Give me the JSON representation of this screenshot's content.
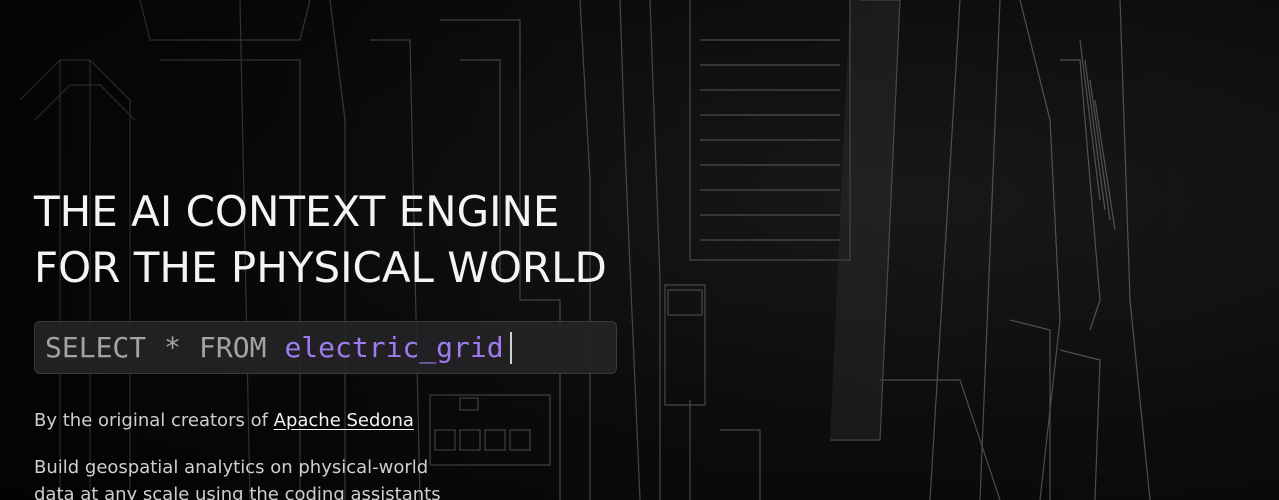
{
  "hero": {
    "headline_line1": "THE AI CONTEXT ENGINE",
    "headline_line2": "FOR THE PHYSICAL WORLD",
    "query": {
      "keyword1": "SELECT",
      "star": "*",
      "keyword2": "FROM",
      "table": "electric_grid"
    },
    "creators_prefix": "By the original creators of ",
    "creators_link": "Apache Sedona",
    "description": "Build geospatial analytics on physical-world data at any scale using the coding assistants"
  },
  "colors": {
    "background": "#0b0b0c",
    "headline": "#f4f4f4",
    "query_keyword": "#a3a3a3",
    "query_table": "#9e7cf0",
    "body_text": "#cfcfcf"
  }
}
